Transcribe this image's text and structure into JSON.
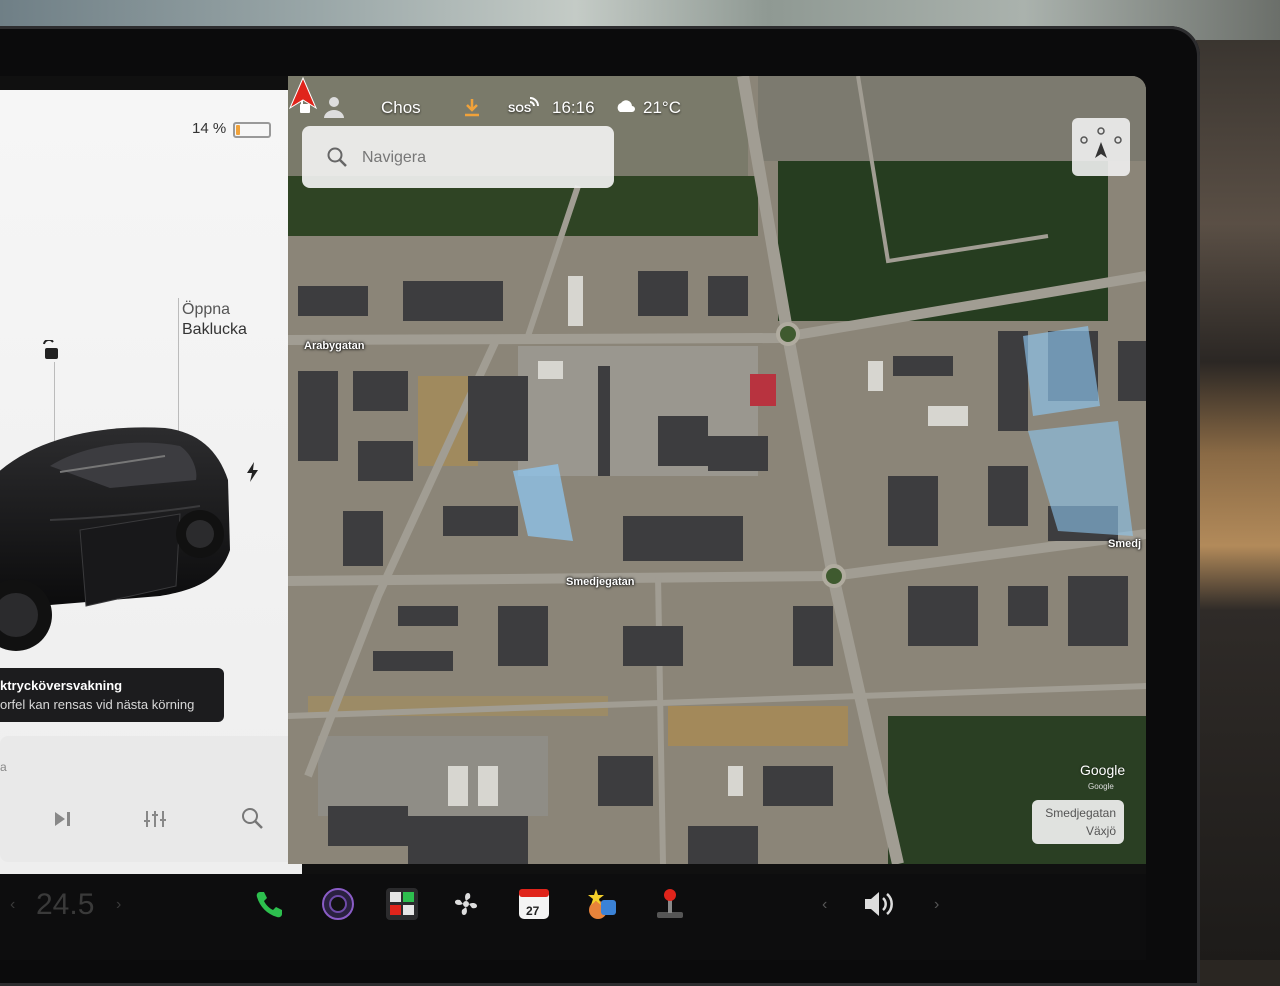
{
  "status_bar": {
    "profile_name": "Chos",
    "sos_label": "SOS",
    "time": "16:16",
    "outside_temperature": "21°C"
  },
  "car_panel": {
    "battery_percent_text": "14 %",
    "battery_level": 0.14,
    "trunk_action_line1": "Öppna",
    "trunk_action_line2": "Baklucka",
    "tpms_title": "ktrycköversvakning",
    "tpms_subtitle": "orfel kan rensas vid nästa körning",
    "media_partial_text": "a"
  },
  "map": {
    "search_placeholder": "Navigera",
    "road_labels": {
      "arabygatan": "Arabygatan",
      "smedjegatan": "Smedjegatan",
      "smedj_edge": "Smedj"
    },
    "attribution": "Google",
    "attribution_small": "Google",
    "location_chip_line1": "Smedjegatan",
    "location_chip_line2": "Växjö"
  },
  "dock": {
    "cabin_temperature": "24.5",
    "calendar_day": "27",
    "icons": [
      "phone-icon",
      "camera-icon",
      "apps-icon",
      "fan-icon",
      "calendar-icon",
      "toybox-icon",
      "joystick-icon",
      "volume-icon"
    ]
  },
  "colors": {
    "accent_red": "#e0241b",
    "battery_orange": "#f0a23a",
    "phone_green": "#2dbf4e"
  }
}
